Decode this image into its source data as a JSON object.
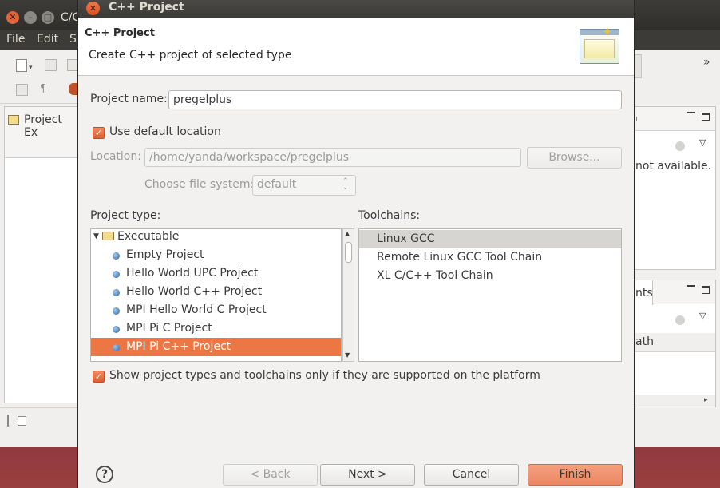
{
  "background_window": {
    "title": "C/C",
    "menu": [
      "File",
      "Edit",
      "S"
    ],
    "project_explorer_tab": "Project Ex",
    "right_panel_text": "not available.",
    "right_tab": "nts",
    "right_column_header": "ath",
    "more_icon": "»"
  },
  "dialog": {
    "window_title": "C++ Project",
    "header_title": "C++ Project",
    "header_subtitle": "Create C++ project of selected type",
    "project_name_label": "Project name:",
    "project_name_value": "pregelplus",
    "use_default_location_label": "Use default location",
    "use_default_location_checked": true,
    "location_label": "Location:",
    "location_value": "/home/yanda/workspace/pregelplus",
    "browse_label": "Browse...",
    "file_system_label": "Choose file system:",
    "file_system_value": "default",
    "project_type_label": "Project type:",
    "project_types": {
      "group": "Executable",
      "items": [
        {
          "label": "Empty Project",
          "selected": false
        },
        {
          "label": "Hello World UPC Project",
          "selected": false
        },
        {
          "label": "Hello World C++ Project",
          "selected": false
        },
        {
          "label": "MPI Hello World C Project",
          "selected": false
        },
        {
          "label": "MPI Pi C Project",
          "selected": false
        },
        {
          "label": "MPI Pi C++ Project",
          "selected": true
        }
      ]
    },
    "toolchains_label": "Toolchains:",
    "toolchains": [
      {
        "label": "Linux GCC",
        "selected": true
      },
      {
        "label": "Remote Linux GCC Tool Chain",
        "selected": false
      },
      {
        "label": "XL C/C++ Tool Chain",
        "selected": false
      }
    ],
    "show_supported_label": "Show project types and toolchains only if they are supported on the platform",
    "show_supported_checked": true,
    "help_label": "?",
    "back_label": "< Back",
    "next_label": "Next >",
    "cancel_label": "Cancel",
    "finish_label": "Finish"
  }
}
